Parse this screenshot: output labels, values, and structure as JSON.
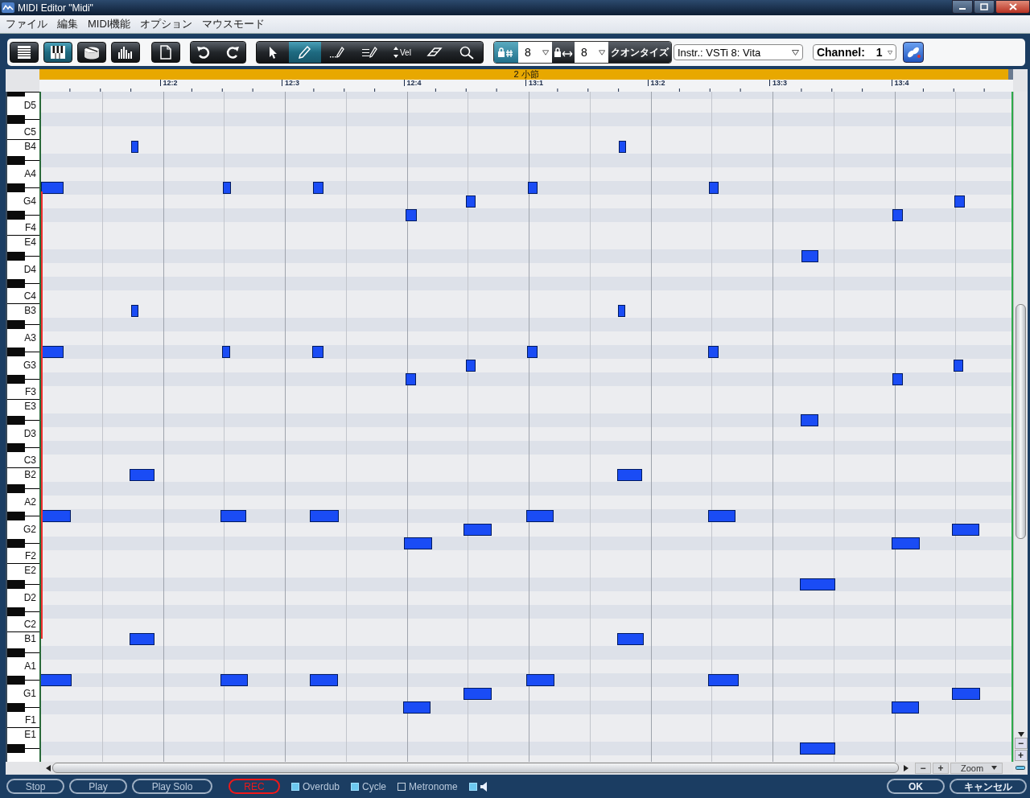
{
  "window": {
    "title": "MIDI Editor \"Midi\""
  },
  "menu": [
    "ファイル",
    "編集",
    "MIDI機能",
    "オプション",
    "マウスモード"
  ],
  "toolbar": {
    "views": [
      {
        "kind": "list",
        "selected": false
      },
      {
        "kind": "piano",
        "selected": true
      },
      {
        "kind": "drum",
        "selected": false
      },
      {
        "kind": "velocity",
        "selected": false
      }
    ],
    "tools": [
      {
        "kind": "pointer",
        "selected": false
      },
      {
        "kind": "pencil",
        "selected": true
      },
      {
        "kind": "line",
        "selected": false
      },
      {
        "kind": "multi",
        "selected": false
      },
      {
        "kind": "vel",
        "label": "Vel",
        "selected": false
      },
      {
        "kind": "eraser",
        "selected": false
      },
      {
        "kind": "zoom",
        "selected": false
      }
    ],
    "grid_value": "8",
    "length_value": "8",
    "quantize_button": "クオンタイズ",
    "instrument": "Instr.: VSTi 8: Vita",
    "channel": {
      "label": "Channel:",
      "value": "1"
    }
  },
  "ruler": {
    "region_label": "2 小節",
    "marks": [
      "12:2",
      "12:3",
      "12:4",
      "13:1",
      "13:2",
      "13:3",
      "13:4"
    ]
  },
  "keyboard": {
    "white_keys": [
      "D5",
      "C5",
      "B4",
      "A4",
      "G4",
      "F4",
      "E4",
      "D4",
      "C4",
      "B3",
      "A3",
      "G3",
      "F3",
      "E3",
      "D3",
      "C3",
      "B2",
      "A2",
      "G2",
      "F2",
      "E2",
      "D2",
      "C2",
      "B1",
      "A1",
      "G1",
      "F1",
      "E1"
    ]
  },
  "h_scroll": {
    "buttons": [
      "−",
      "+"
    ],
    "zoom": "Zoom"
  },
  "v_scroll": {
    "buttons": [
      "−",
      "+"
    ]
  },
  "transport": {
    "buttons": [
      {
        "label": "Stop",
        "kind": "normal"
      },
      {
        "label": "Play",
        "kind": "normal"
      },
      {
        "label": "Play Solo",
        "kind": "normal"
      },
      {
        "label": "REC",
        "kind": "record"
      }
    ],
    "toggles": [
      {
        "kind": "labeled",
        "label": "Overdub",
        "checked": true
      },
      {
        "kind": "labeled",
        "label": "Cycle",
        "checked": true
      },
      {
        "kind": "labeled",
        "label": "Metronome",
        "checked": false
      },
      {
        "kind": "speaker",
        "checked": true
      }
    ],
    "dialog_buttons": [
      "OK",
      "キャンセル"
    ]
  }
}
